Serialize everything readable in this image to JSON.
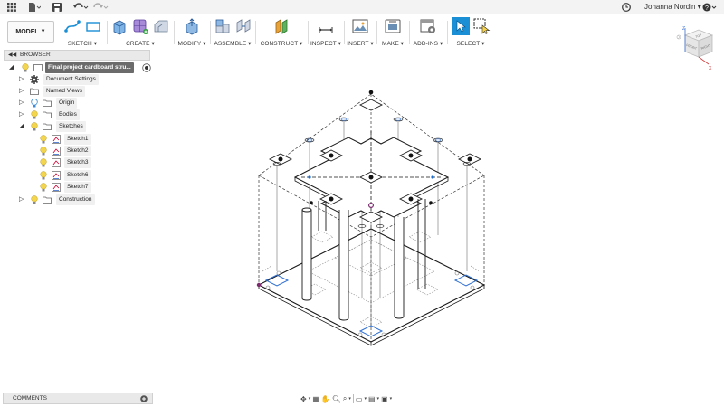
{
  "titlebar": {
    "user_name": "Johanna Nordin ▾",
    "icons": [
      "grid-icon",
      "file-icon",
      "save-icon",
      "undo-icon",
      "redo-icon",
      "clock-icon",
      "help-icon"
    ]
  },
  "toolbar": {
    "workspace_label": "MODEL",
    "groups": [
      {
        "label": "SKETCH ▾"
      },
      {
        "label": "CREATE ▾"
      },
      {
        "label": "MODIFY ▾"
      },
      {
        "label": "ASSEMBLE ▾"
      },
      {
        "label": "CONSTRUCT ▾"
      },
      {
        "label": "INSPECT ▾"
      },
      {
        "label": "INSERT ▾"
      },
      {
        "label": "MAKE ▾"
      },
      {
        "label": "ADD-INS ▾"
      },
      {
        "label": "SELECT ▾"
      }
    ]
  },
  "browser": {
    "title": "BROWSER",
    "root": "Final project cardboard stru...",
    "items": [
      {
        "label": "Document Settings"
      },
      {
        "label": "Named Views"
      },
      {
        "label": "Origin"
      },
      {
        "label": "Bodies"
      },
      {
        "label": "Sketches"
      },
      {
        "label": "Sketch1"
      },
      {
        "label": "Sketch2"
      },
      {
        "label": "Sketch3"
      },
      {
        "label": "Sketch6"
      },
      {
        "label": "Sketch7"
      },
      {
        "label": "Construction"
      }
    ]
  },
  "comments": {
    "label": "COMMENTS"
  },
  "viewcube": {
    "top": "TOP",
    "front": "FRONT",
    "right": "RIGHT"
  },
  "colors": {
    "accent": "#1a8fd6",
    "selection_bg": "#6b6b6b",
    "sketch_blue": "#2e6fd1",
    "point_purple": "#7a2a6d"
  }
}
